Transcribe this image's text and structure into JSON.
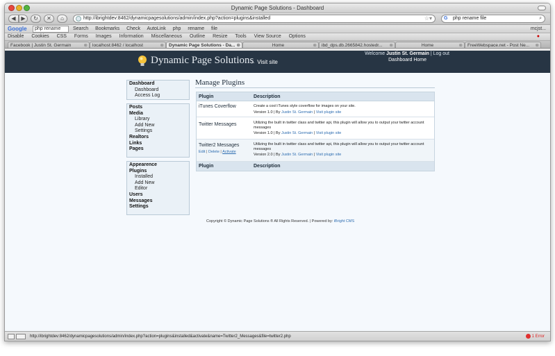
{
  "window": {
    "title": "Dynamic Page Solutions - Dashboard"
  },
  "nav": {
    "url": "http://ibrightdev:8462/dynamicpagesolutions/admin/index.php?action=plugins&installed",
    "search_value": "php rename file"
  },
  "google_toolbar": {
    "logo": "Google",
    "query": "php rename",
    "items": [
      "Search",
      "·",
      "+",
      "·",
      "Bookmarks",
      "Check",
      "AutoLink",
      "php",
      "rename",
      "file"
    ],
    "right": "mcjst..."
  },
  "dev_toolbar": {
    "items": [
      "Disable",
      "Cookies",
      "CSS",
      "Forms",
      "Images",
      "Information",
      "Miscellaneous",
      "Outline",
      "Resize",
      "Tools",
      "View Source",
      "Options"
    ]
  },
  "tabs": [
    {
      "label": "Facebook | Justin St. Germain"
    },
    {
      "label": "localhost:8462 / localhost"
    },
    {
      "label": "Dynamic Page Solutions - Da..."
    },
    {
      "label": "Home"
    },
    {
      "label": "ibd_dps.db.2665842.hostedr..."
    },
    {
      "label": "Home"
    },
    {
      "label": "FreeWebspace.net - Post Ne..."
    }
  ],
  "site": {
    "title": "Dynamic Page Solutions",
    "visit_site": "← Visit site",
    "welcome_prefix": "Welcome",
    "user": "Justin St. Germain",
    "log_out": "| Log out",
    "dashboard_home": "Dashboard Home"
  },
  "sidebar": {
    "group1": [
      {
        "label": "Dashboard",
        "type": "h"
      },
      {
        "label": "Dashboard",
        "type": "s"
      },
      {
        "label": "Access Log",
        "type": "s"
      }
    ],
    "group2": [
      {
        "label": "Posts",
        "type": "h"
      },
      {
        "label": "Media",
        "type": "h"
      },
      {
        "label": "Library",
        "type": "s"
      },
      {
        "label": "Add New",
        "type": "s"
      },
      {
        "label": "Settings",
        "type": "s"
      },
      {
        "label": "Realtors",
        "type": "h"
      },
      {
        "label": "Links",
        "type": "h"
      },
      {
        "label": "Pages",
        "type": "h"
      }
    ],
    "group3": [
      {
        "label": "Appearence",
        "type": "h"
      },
      {
        "label": "Plugins",
        "type": "h"
      },
      {
        "label": "Installed",
        "type": "s"
      },
      {
        "label": "Add New",
        "type": "s"
      },
      {
        "label": "Editor",
        "type": "s"
      },
      {
        "label": "Users",
        "type": "h"
      },
      {
        "label": "Messages",
        "type": "h"
      },
      {
        "label": "Settings",
        "type": "h"
      }
    ]
  },
  "main": {
    "heading": "Manage Plugins",
    "columns": {
      "plugin": "Plugin",
      "description": "Description"
    },
    "plugins": [
      {
        "name": "iTunes Coverflow",
        "description": "Create a cool iTunes style coverflow for images on your site.",
        "version": "Version 1.0",
        "by": "| By",
        "author": "Justin St. Germain",
        "sep": "|",
        "visit": "Visit plugin site"
      },
      {
        "name": "Twitter Messages",
        "description": "Utilizing the built in twitter class and twitter api, this plugin will allow you to output your twitter account messages",
        "version": "Version 1.0",
        "by": "| By",
        "author": "Justin St. Germain",
        "sep": "|",
        "visit": "Visit plugin site"
      },
      {
        "name": "Twitter2 Messages",
        "description": "Utilizing the built in twitter class and twitter api, this plugin will allow you to output your twitter account messages",
        "version": "Version 2.0",
        "by": "| By",
        "author": "Justin St. Germain",
        "sep": "|",
        "visit": "Visit plugin site",
        "actions": {
          "edit": "Edit",
          "delete": "Delete",
          "activate": "Activate",
          "sep": "|"
        }
      }
    ],
    "copyright_text": "Copyright © Dynamic Page Solutions ® All Rights Reserved. | Powered by:",
    "powered_by": "iBright CMS"
  },
  "status": {
    "url": "http://ibrightdev:8462/dynamicpagesolutions/admin/index.php?action=plugins&installed&activate&name=Twitter2_Messages&file=twitter2.php",
    "error": "1 Error"
  }
}
